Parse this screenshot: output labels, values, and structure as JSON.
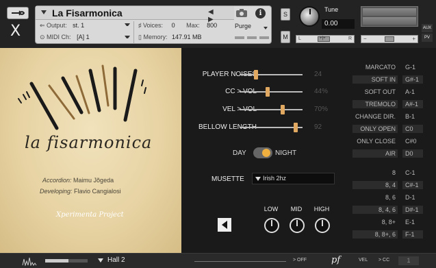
{
  "header": {
    "instrument_title": "La Fisarmonica",
    "output_label": "Output:",
    "output_value": "st. 1",
    "voices_label": "Voices:",
    "voices_value": "0",
    "max_label": "Max:",
    "max_value": "800",
    "purge_label": "Purge",
    "midi_label": "MIDI Ch:",
    "midi_value": "[A]  1",
    "memory_label": "Memory:",
    "memory_value": "147.91 MB",
    "close_glyph": "X",
    "s_button": "S",
    "m_button": "M",
    "tune_label": "Tune",
    "tune_value": "0.00",
    "pan_left": "L",
    "pan_right": "R",
    "pan_center": "+|+",
    "vol_minus": "−",
    "vol_plus": "+",
    "aux_tag": "AUX",
    "pv_tag": "PV",
    "nav_arrows": "◀ ▶"
  },
  "artwork": {
    "logo_text": "la fisarmonica",
    "accordion_label": "Accordion:",
    "accordion_name": "Maimu Jõgeda",
    "developing_label": "Developing:",
    "developing_name": "Flavio Cangialosi",
    "signature": "Xperimenta Project"
  },
  "controls": {
    "sliders": [
      {
        "label": "PLAYER NOISES",
        "value": "24",
        "fraction": 0.24
      },
      {
        "label": "CC > VOL",
        "value": "44%",
        "fraction": 0.44
      },
      {
        "label": "VEL > VOL",
        "value": "70%",
        "fraction": 0.7
      },
      {
        "label": "BELLOW LENGTH",
        "value": "92",
        "fraction": 0.92
      }
    ],
    "day_label": "DAY",
    "night_label": "NIGHT",
    "musette_label": "MUSETTE",
    "musette_value": "Irish 2hz",
    "eq": {
      "low": "LOW",
      "mid": "MID",
      "high": "HIGH"
    }
  },
  "keyswitches_articulations": [
    {
      "name": "MARCATO",
      "key": "G-1",
      "boxed": false
    },
    {
      "name": "SOFT IN",
      "key": "G#-1",
      "boxed": true
    },
    {
      "name": "SOFT OUT",
      "key": "A-1",
      "boxed": false
    },
    {
      "name": "TREMOLO",
      "key": "A#-1",
      "boxed": true
    },
    {
      "name": "CHANGE DIR.",
      "key": "B-1",
      "boxed": false
    },
    {
      "name": "ONLY OPEN",
      "key": "C0",
      "boxed": true
    },
    {
      "name": "ONLY CLOSE",
      "key": "C#0",
      "boxed": false
    },
    {
      "name": "AIR",
      "key": "D0",
      "boxed": true
    }
  ],
  "keyswitches_registers": [
    {
      "name": "8",
      "key": "C-1",
      "boxed": false
    },
    {
      "name": "8, 4",
      "key": "C#-1",
      "boxed": true
    },
    {
      "name": "8, 6",
      "key": "D-1",
      "boxed": false
    },
    {
      "name": "8, 4, 6",
      "key": "D#-1",
      "boxed": true
    },
    {
      "name": "8, 8+",
      "key": "E-1",
      "boxed": false
    },
    {
      "name": "8, 8+, 6",
      "key": "F-1",
      "boxed": true
    }
  ],
  "footer": {
    "reverb_name": "Hall 2",
    "reverb_off": "> OFF",
    "pf_logo": "pf",
    "vel_label": "VEL",
    "cc_label": "> CC",
    "number_value": "1"
  },
  "colors": {
    "accent": "#e0a860",
    "toggle_knob": "#f0b040",
    "background": "#1a1a1a",
    "parchment": "#e7d3a3"
  }
}
